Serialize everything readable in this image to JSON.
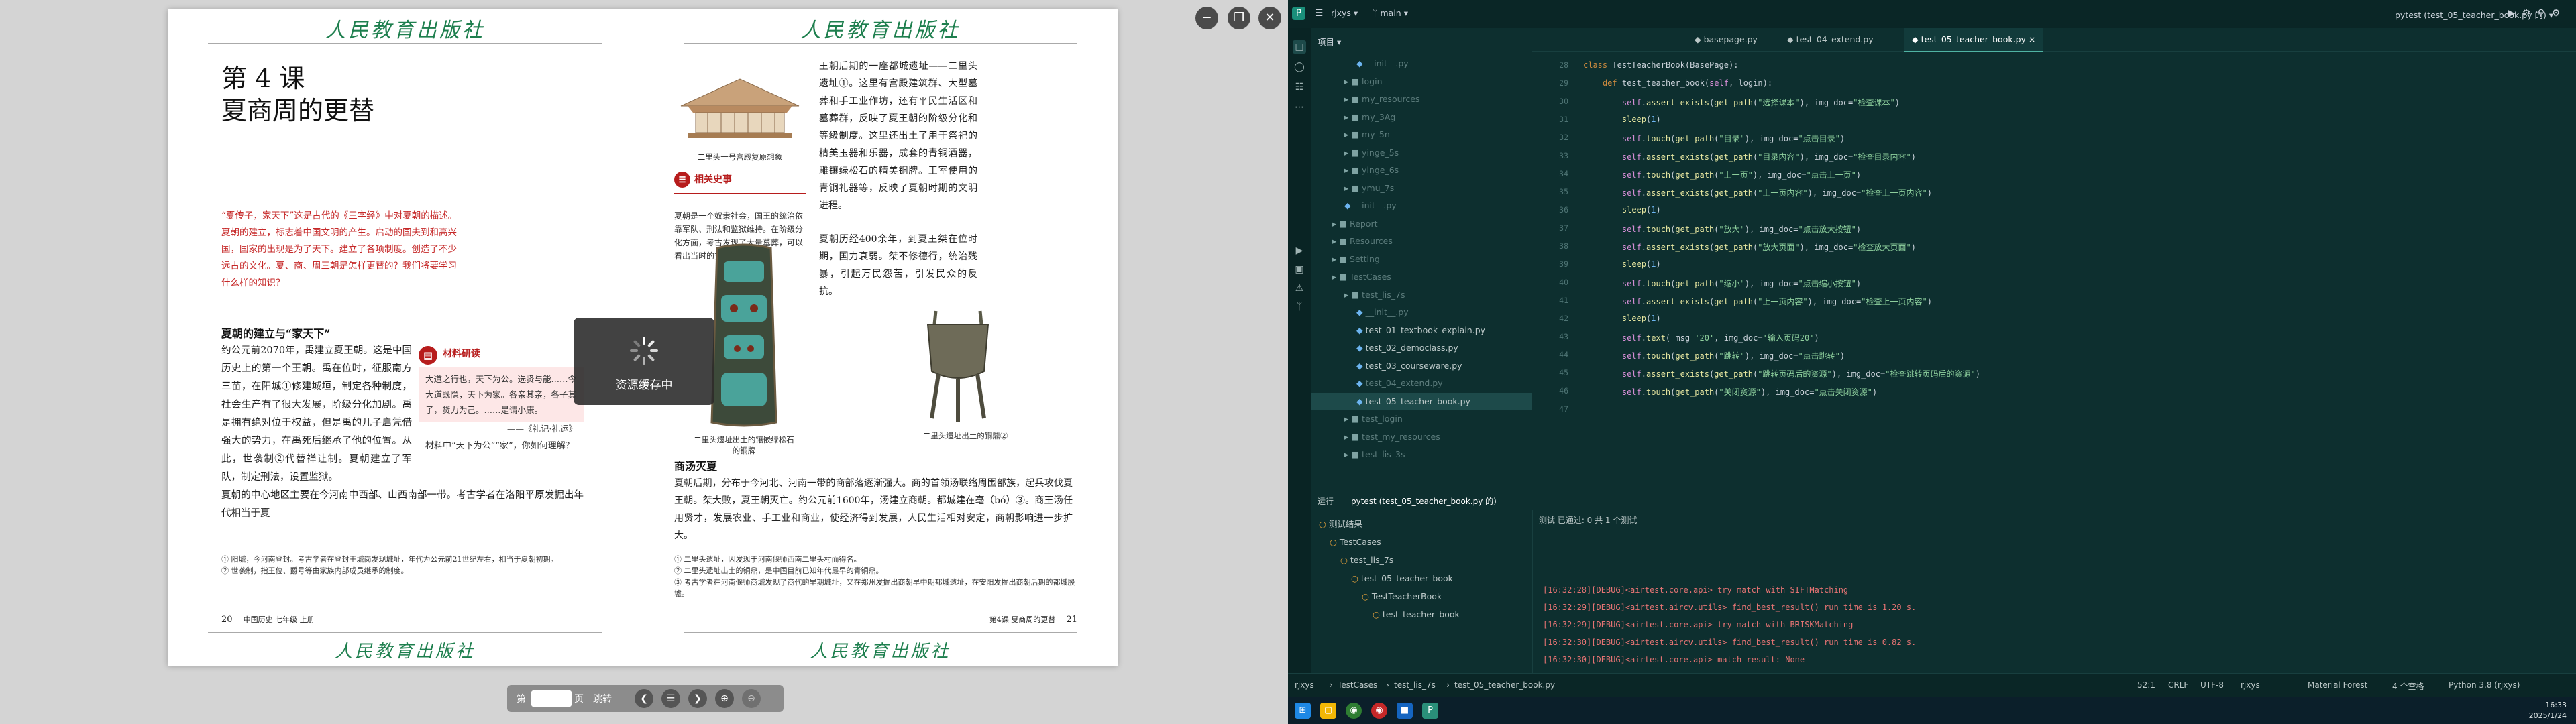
{
  "reader": {
    "publisher_mark": "人民教育出版社",
    "left_page": {
      "lesson_no": "第 4 课",
      "lesson_title": "夏商周的更替",
      "intro": "“夏传子，家天下”这是古代的《三字经》中对夏朝的描述。夏朝的建立，标志着中国文明的产生。启动的国夫到和高兴国，国家的出现是为了天下。建立了各项制度。创造了不少远古的文化。夏、商、周三朝是怎样更替的？我们将要学习什么样的知识？",
      "section1_head": "夏朝的建立与“家天下”",
      "section1_body": "约公元前2070年，禹建立夏王朝。这是中国历史上的第一个王朝。禹在位时，征服南方三苗，在阳城①修建城垣，制定各种制度，社会生产有了很大发展，阶级分化加剧。禹是拥有绝对位于权益，但是禹的儿子启凭借强大的势力，在禹死后继承了他的位置。从此，世袭制②代替禅让制。夏朝建立了军队，制定刑法，设置监狱。",
      "section1_body2": "夏朝的中心地区主要在今河南中西部、山西南部一带。考古学者在洛阳平原发掘出年代相当于夏",
      "box_head": "材料研读",
      "box_quote": "大道之行也，天下为公。选贤与能……今大道既隐，天下为家。各亲其亲，各子其子，货力为己。……是谓小康。",
      "box_source": "——《礼记·礼运》",
      "box_question": "材料中“天下为公”“家”，你如何理解？",
      "footnote1": "① 阳城，今河南登封。考古学者在登封王城岗发现城址，年代为公元前21世纪左右，相当于夏朝初期。",
      "footnote2": "② 世袭制，指王位、爵号等由家族内部成员继承的制度。",
      "page_num": "20",
      "page_label": "中国历史 七年级 上册"
    },
    "right_page": {
      "hall_caption": "二里头一号宫殿复原想象",
      "related_head": "相关史事",
      "related_text": "夏朝是一个奴隶社会，国王的统治依靠军队、刑法和监狱维持。在阶级分化方面，考古发现了大量墓葬，可以看出当时的贫富分化情况。",
      "col1_text": "王朝后期的一座都城遗址——二里头遗址①。这里有宫殿建筑群、大型墓葬和手工业作坊，还有平民生活区和墓葬群，反映了夏王朝的阶级分化和等级制度。这里还出土了用于祭祀的精美玉器和乐器，成套的青铜酒器，雕镶绿松石的精美铜牌。王室使用的青铜礼器等，反映了夏朝时期的文明进程。",
      "col1_text2": "夏朝历经400余年，到夏王桀在位时期，国力衰弱。桀不修德行，统治残暴，引起万民怨苦，引发民众的反抗。",
      "artifact1_caption": "二里头遗址出土的镶嵌绿松石的铜牌",
      "artifact2_caption": "二里头遗址出土的铜鼎②",
      "section2_head": "商汤灭夏",
      "section2_body": "夏朝后期，分布于今河北、河南一带的商部落逐渐强大。商的首领汤联络周围部族，起兵攻伐夏王朝。桀大败，夏王朝灭亡。约公元前1600年，汤建立商朝。都城建在亳（bó）③。商王汤任用贤才，发展农业、手工业和商业，使经济得到发展，人民生活相对安定，商朝影响进一步扩大。",
      "footnote1": "① 二里头遗址，因发现于河南偃师西南二里头村而得名。",
      "footnote2": "② 二里头遗址出土的铜鼎，是中国目前已知年代最早的青铜鼎。",
      "footnote3": "③ 考古学者在河南偃师商城发现了商代的早期城址，又在郑州发掘出商朝早中期都城遗址，在安阳发掘出商朝后期的都城殷墟。",
      "page_label": "第4课 夏商周的更替",
      "page_num": "21"
    },
    "loader_text": "资源缓存中",
    "bottombar": {
      "label_pre": "第",
      "label_post": "页",
      "go_label": "跳转",
      "page_value": ""
    }
  },
  "ide": {
    "titlebar": {
      "project": "rjxys",
      "branch": "main",
      "run_config": "pytest (test_05_teacher_book.py 的)"
    },
    "project_panel_title": "项目",
    "tree": [
      {
        "label": "__init__.py",
        "indent": 3,
        "kind": "py",
        "dim": true
      },
      {
        "label": "login",
        "indent": 2,
        "kind": "folder",
        "dim": true
      },
      {
        "label": "my_resources",
        "indent": 2,
        "kind": "folder",
        "dim": true
      },
      {
        "label": "my_3Ag",
        "indent": 2,
        "kind": "folder",
        "dim": true
      },
      {
        "label": "my_5n",
        "indent": 2,
        "kind": "folder",
        "dim": true
      },
      {
        "label": "yinge_5s",
        "indent": 2,
        "kind": "folder",
        "dim": true
      },
      {
        "label": "yinge_6s",
        "indent": 2,
        "kind": "folder",
        "dim": true
      },
      {
        "label": "ymu_7s",
        "indent": 2,
        "kind": "folder",
        "dim": true
      },
      {
        "label": "__init__.py",
        "indent": 2,
        "kind": "py",
        "dim": true
      },
      {
        "label": "Report",
        "indent": 1,
        "kind": "folder",
        "dim": true
      },
      {
        "label": "Resources",
        "indent": 1,
        "kind": "folder",
        "dim": true
      },
      {
        "label": "Setting",
        "indent": 1,
        "kind": "folder",
        "dim": true
      },
      {
        "label": "TestCases",
        "indent": 1,
        "kind": "folder",
        "dim": true
      },
      {
        "label": "test_lis_7s",
        "indent": 2,
        "kind": "folder",
        "dim": true
      },
      {
        "label": "__init__.py",
        "indent": 3,
        "kind": "py",
        "dim": true
      },
      {
        "label": "test_01_textbook_explain.py",
        "indent": 3,
        "kind": "py",
        "dim": false
      },
      {
        "label": "test_02_democlass.py",
        "indent": 3,
        "kind": "py",
        "dim": false
      },
      {
        "label": "test_03_courseware.py",
        "indent": 3,
        "kind": "py",
        "dim": false
      },
      {
        "label": "test_04_extend.py",
        "indent": 3,
        "kind": "py",
        "dim": true
      },
      {
        "label": "test_05_teacher_book.py",
        "indent": 3,
        "kind": "py",
        "dim": false,
        "sel": true
      },
      {
        "label": "test_login",
        "indent": 2,
        "kind": "folder",
        "dim": true
      },
      {
        "label": "test_my_resources",
        "indent": 2,
        "kind": "folder",
        "dim": true
      },
      {
        "label": "test_lis_3s",
        "indent": 2,
        "kind": "folder",
        "dim": true
      }
    ],
    "tabs": [
      {
        "label": "basepage.py",
        "active": false
      },
      {
        "label": "test_04_extend.py",
        "active": false
      },
      {
        "label": "test_05_teacher_book.py",
        "active": true
      }
    ],
    "code_lines": [
      {
        "n": "28",
        "t": "class TestTeacherBook(BasePage):"
      },
      {
        "n": "29",
        "t": "    def test_teacher_book(self, login):"
      },
      {
        "n": "30",
        "t": "        self.assert_exists(get_path(\"选择课本\"), img_doc=\"检查课本\")"
      },
      {
        "n": "31",
        "t": "        sleep(1)"
      },
      {
        "n": "32",
        "t": "        self.touch(get_path(\"目录\"), img_doc=\"点击目录\")"
      },
      {
        "n": "33",
        "t": "        self.assert_exists(get_path(\"目录内容\"), img_doc=\"检查目录内容\")"
      },
      {
        "n": "34",
        "t": "        self.touch(get_path(\"上一页\"), img_doc=\"点击上一页\")"
      },
      {
        "n": "35",
        "t": "        self.assert_exists(get_path(\"上一页内容\"), img_doc=\"检查上一页内容\")"
      },
      {
        "n": "36",
        "t": "        sleep(1)"
      },
      {
        "n": "37",
        "t": "        self.touch(get_path(\"放大\"), img_doc=\"点击放大按钮\")"
      },
      {
        "n": "38",
        "t": "        self.assert_exists(get_path(\"放大页面\"), img_doc=\"检查放大页面\")"
      },
      {
        "n": "39",
        "t": "        sleep(1)"
      },
      {
        "n": "40",
        "t": "        self.touch(get_path(\"缩小\"), img_doc=\"点击缩小按钮\")"
      },
      {
        "n": "41",
        "t": "        self.assert_exists(get_path(\"上一页内容\"), img_doc=\"检查上一页内容\")"
      },
      {
        "n": "42",
        "t": "        sleep(1)"
      },
      {
        "n": "43",
        "t": "        self.text( msg '20', img_doc='输入页码20')"
      },
      {
        "n": "44",
        "t": "        self.touch(get_path(\"跳转\"), img_doc=\"点击跳转\")"
      },
      {
        "n": "45",
        "t": "        self.assert_exists(get_path(\"跳转页码后的资源\"), img_doc=\"检查跳转页码后的资源\")"
      },
      {
        "n": "46",
        "t": "        self.touch(get_path(\"关闭资源\"), img_doc=\"点击关闭资源\")"
      },
      {
        "n": "47",
        "t": ""
      }
    ],
    "run": {
      "tab_label": "运行",
      "config_tab": "pytest (test_05_teacher_book.py 的)",
      "status": "测试 已通过: 0 共 1 个测试",
      "tree": [
        {
          "label": "测试结果",
          "indent": 0
        },
        {
          "label": "TestCases",
          "indent": 1
        },
        {
          "label": "test_lis_7s",
          "indent": 2
        },
        {
          "label": "test_05_teacher_book",
          "indent": 3
        },
        {
          "label": "TestTeacherBook",
          "indent": 4
        },
        {
          "label": "test_teacher_book",
          "indent": 5
        }
      ],
      "logs": [
        "[16:32:28][DEBUG]<airtest.core.api> try match with SIFTMatching",
        "[16:32:29][DEBUG]<airtest.aircv.utils> find_best_result() run time is 1.20 s.",
        "[16:32:29][DEBUG]<airtest.core.api> try match with BRISKMatching",
        "[16:32:30][DEBUG]<airtest.aircv.utils> find_best_result() run time is 0.82 s.",
        "[16:32:30][DEBUG]<airtest.core.api> match result: None"
      ]
    },
    "status": {
      "crumb1": "rjxys",
      "crumb2": "TestCases",
      "crumb3": "test_lis_7s",
      "crumb4": "test_05_teacher_book.py",
      "position": "52:1",
      "eol": "CRLF",
      "encoding": "UTF-8",
      "vcs": "rjxys",
      "theme": "Material Forest",
      "indent": "4 个空格",
      "interpreter": "Python 3.8 (rjxys)"
    },
    "clock": {
      "time": "16:33",
      "date": "2025/1/24"
    }
  },
  "colors": {
    "accent": "#4fb3a3",
    "log_red": "#e57373",
    "book_green": "#1e7f4e"
  }
}
